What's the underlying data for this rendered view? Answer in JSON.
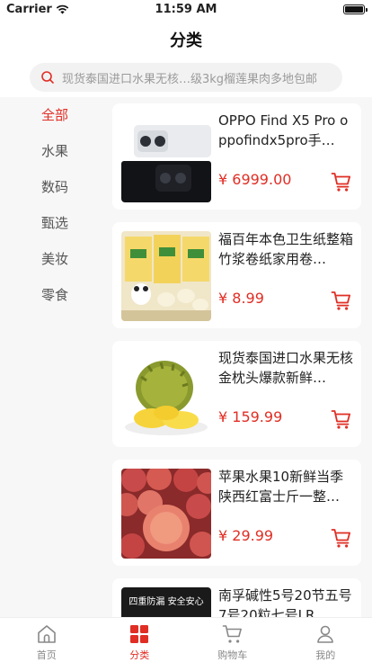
{
  "status_bar": {
    "carrier": "Carrier",
    "time": "11:59 AM"
  },
  "header": {
    "title": "分类"
  },
  "search": {
    "placeholder": "现货泰国进口水果无核…级3kg榴莲果肉多地包邮"
  },
  "categories": [
    {
      "label": "全部",
      "active": true
    },
    {
      "label": "水果"
    },
    {
      "label": "数码"
    },
    {
      "label": "甄选"
    },
    {
      "label": "美妆"
    },
    {
      "label": "零食"
    }
  ],
  "products": [
    {
      "name": "OPPO Find X5 Pro oppofindx5pro手…",
      "price": "¥ 6999.00",
      "thumb": "phone"
    },
    {
      "name": "福百年本色卫生纸整箱竹浆卷纸家用卷…",
      "price": "¥ 8.99",
      "thumb": "tissue"
    },
    {
      "name": "现货泰国进口水果无核金枕头爆款新鲜…",
      "price": "¥ 159.99",
      "thumb": "durian"
    },
    {
      "name": "苹果水果10新鲜当季陕西红富士斤一整…",
      "price": "¥ 29.99",
      "thumb": "apple"
    },
    {
      "name": "南孚碱性5号20节五号7号20粒七号LR…",
      "price": "",
      "thumb": "battery",
      "thumb_text": "四重防漏 安全安心"
    }
  ],
  "tabs": [
    {
      "label": "首页",
      "icon": "home-icon"
    },
    {
      "label": "分类",
      "icon": "category-grid-icon",
      "active": true
    },
    {
      "label": "购物车",
      "icon": "cart-icon"
    },
    {
      "label": "我的",
      "icon": "user-icon"
    }
  ],
  "colors": {
    "accent": "#e02e24",
    "sidebar_bg": "#f7f7f7",
    "search_bg": "#f2f2f2"
  }
}
